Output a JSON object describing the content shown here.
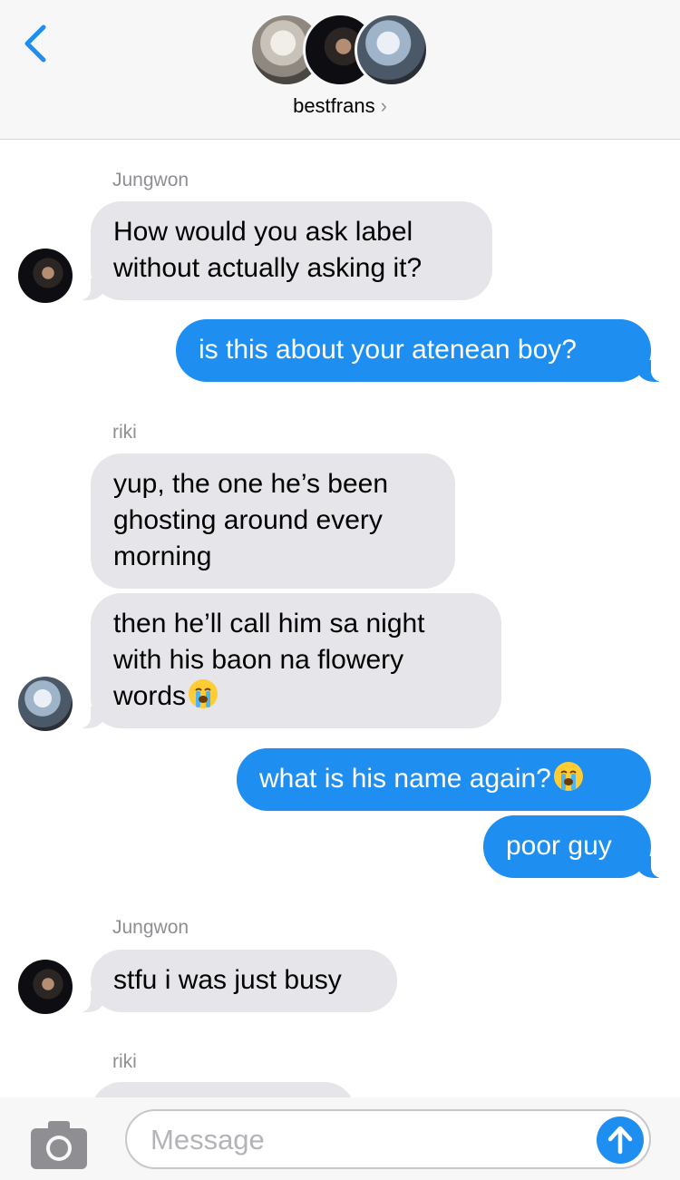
{
  "header": {
    "group_name": "bestfrans",
    "chevron": "›",
    "back_icon": "chevron-left-icon",
    "accent_color": "#1f8ef1"
  },
  "messages": [
    {
      "sender": "Jungwon",
      "side": "in",
      "text": "How would you ask label without actually asking it?"
    },
    {
      "side": "out",
      "text": "is this about your atenean boy?"
    },
    {
      "sender": "riki",
      "side": "in",
      "text": "yup, the one he’s been ghosting around every morning"
    },
    {
      "side": "in",
      "text": "then he’ll call him sa night with his baon na flowery words",
      "emoji": "loudly-crying-face"
    },
    {
      "side": "out",
      "text": "what is his name again?",
      "emoji": "loudly-crying-face"
    },
    {
      "side": "out",
      "text": "poor guy"
    },
    {
      "sender": "Jungwon",
      "side": "in",
      "text": "stfu i was just busy"
    },
    {
      "sender": "riki",
      "side": "in",
      "text": ""
    }
  ],
  "input": {
    "placeholder": "Message",
    "value": ""
  },
  "colors": {
    "incoming_bubble": "#e5e5ea",
    "outgoing_bubble": "#1f8ef1",
    "sender_label": "#8e8e93"
  }
}
